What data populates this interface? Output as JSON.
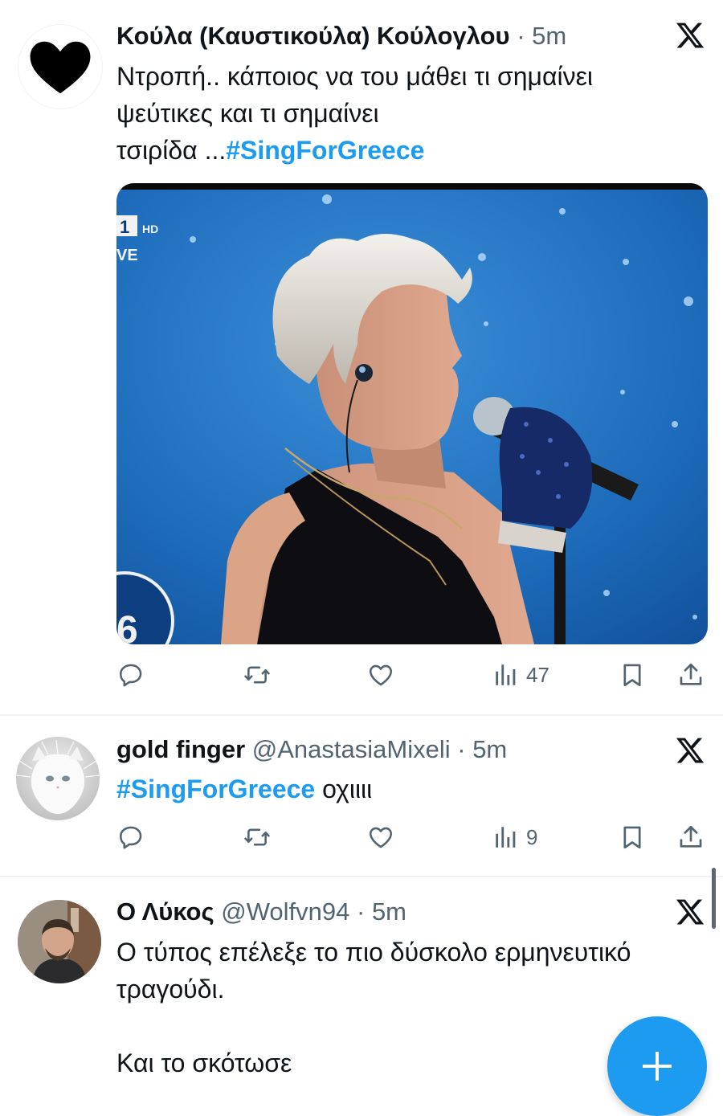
{
  "colors": {
    "accent": "#1d9bf0",
    "text": "#0f1419",
    "secondary": "#536471",
    "divider": "#eff3f4"
  },
  "tweets": [
    {
      "name": "Κούλα (Καυστικούλα) Κούλογλου",
      "handle": "",
      "time": "5m",
      "avatar_icon": "black-heart",
      "text_line1": "Ντροπή.. κάποιος να του μάθει τι σημαίνει",
      "text_line2": "ψεύτικες και τι σημαίνει",
      "text_line3_prefix": "τσιρίδα ...",
      "hashtag": "#SingForGreece",
      "media": {
        "channel_number": "1",
        "channel_hd": "HD",
        "live_text": "VE",
        "corner_number": "6"
      },
      "views": "47"
    },
    {
      "name": "gold finger",
      "handle": "@AnastasiaMixeli",
      "time": "5m",
      "avatar_icon": "white-cat-photo",
      "hashtag": "#SingForGreece",
      "text_suffix": " οχιιιι",
      "views": "9"
    },
    {
      "name": "Ο Λύκος",
      "handle": "@Wolfvn94",
      "time": "5m",
      "avatar_icon": "person-photo",
      "text_line1": "Ο τύπος επέλεξε το πιο δύσκολο ερμηνευτικό",
      "text_line2": "τραγούδι.",
      "text_line3": "Και το σκότωσε"
    }
  ],
  "separator": " · ",
  "fab_icon": "plus-icon"
}
